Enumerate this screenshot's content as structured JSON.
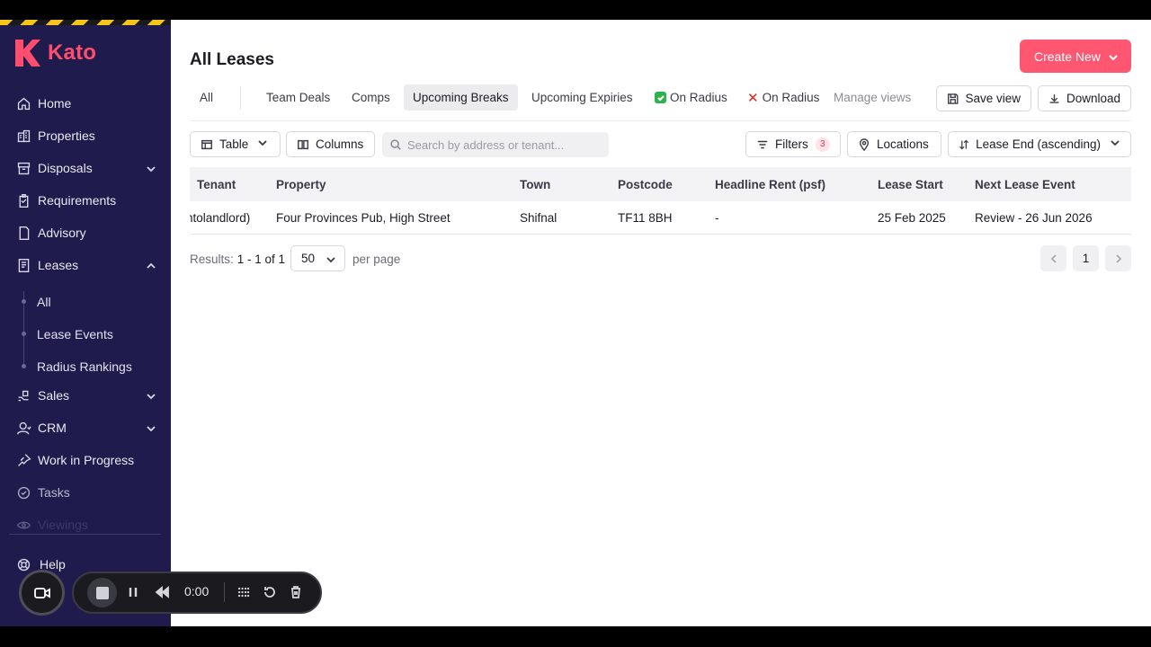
{
  "app": {
    "name": "Kato",
    "brand_color": "#ff4d6d"
  },
  "sidebar": {
    "items": [
      {
        "label": "Home",
        "icon": "home-icon"
      },
      {
        "label": "Properties",
        "icon": "building-icon"
      },
      {
        "label": "Disposals",
        "icon": "disposals-icon",
        "expandable": true
      },
      {
        "label": "Requirements",
        "icon": "clipboard-icon"
      },
      {
        "label": "Advisory",
        "icon": "document-icon"
      },
      {
        "label": "Leases",
        "icon": "lease-icon",
        "expanded": true
      },
      {
        "label": "Sales",
        "icon": "sales-icon",
        "expandable": true
      },
      {
        "label": "CRM",
        "icon": "person-icon",
        "expandable": true
      },
      {
        "label": "Work in Progress",
        "icon": "pin-icon"
      },
      {
        "label": "Tasks",
        "icon": "check-circle-icon"
      },
      {
        "label": "Viewings",
        "icon": "eye-icon"
      }
    ],
    "lease_sub_items": [
      "All",
      "Lease Events",
      "Radius Rankings"
    ],
    "help_label": "Help"
  },
  "header": {
    "title": "All Leases",
    "create_label": "Create New"
  },
  "tabs": {
    "all": "All",
    "team_deals": "Team Deals",
    "comps": "Comps",
    "upcoming_breaks": "Upcoming Breaks",
    "upcoming_expiries": "Upcoming Expiries",
    "on_radius_check": "On Radius",
    "on_radius_cross": "On Radius",
    "manage_views": "Manage views",
    "save_view": "Save view",
    "download": "Download",
    "active": "Upcoming Breaks"
  },
  "toolbar": {
    "view_mode": "Table",
    "columns_label": "Columns",
    "search_placeholder": "Search by address or tenant...",
    "filters_label": "Filters",
    "filters_count": "3",
    "locations_label": "Locations",
    "sort_label": "Lease End (ascending)"
  },
  "table": {
    "headers": [
      "Tenant",
      "Property",
      "Town",
      "Postcode",
      "Headline Rent (psf)",
      "Lease Start",
      "Next Lease Event"
    ],
    "rows": [
      {
        "tenant": "ntolandlord)",
        "property": "Four Provinces Pub, High Street",
        "town": "Shifnal",
        "postcode": "TF11 8BH",
        "headline_rent": "-",
        "lease_start": "25 Feb 2025",
        "next_lease_event": "Review - 26 Jun 2026"
      }
    ]
  },
  "pagination": {
    "results_label": "Results:",
    "results_value": "1 - 1 of 1",
    "per_page_value": "50",
    "per_page_label": "per page",
    "current_page": "1"
  },
  "recorder": {
    "time": "0:00"
  }
}
